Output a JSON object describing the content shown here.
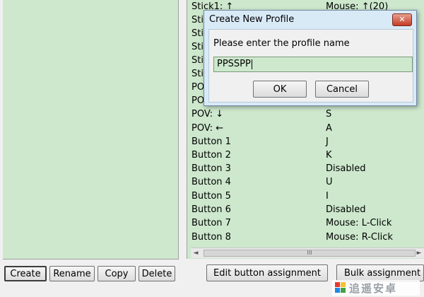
{
  "left_buttons": [
    "Create",
    "Rename",
    "Copy",
    "Delete"
  ],
  "mapping_rows": [
    {
      "key": "Stick1: ↑",
      "value": "Mouse: ↑(20)"
    },
    {
      "key": "Stic",
      "value": ""
    },
    {
      "key": "Stic",
      "value": ""
    },
    {
      "key": "Stic",
      "value": ""
    },
    {
      "key": "Stic",
      "value": ""
    },
    {
      "key": "Stic",
      "value": ""
    },
    {
      "key": "POV",
      "value": ""
    },
    {
      "key": "POV",
      "value": ""
    },
    {
      "key": "POV: ↓",
      "value": "S"
    },
    {
      "key": "POV: ←",
      "value": "A"
    },
    {
      "key": "Button 1",
      "value": "J"
    },
    {
      "key": "Button 2",
      "value": "K"
    },
    {
      "key": "Button 3",
      "value": "Disabled"
    },
    {
      "key": "Button 4",
      "value": "U"
    },
    {
      "key": "Button 5",
      "value": "I"
    },
    {
      "key": "Button 6",
      "value": "Disabled"
    },
    {
      "key": "Button 7",
      "value": "Mouse: L-Click"
    },
    {
      "key": "Button 8",
      "value": "Mouse: R-Click"
    }
  ],
  "right_buttons": {
    "edit": "Edit button assignment",
    "bulk": "Bulk assignment w"
  },
  "scrollbar": {
    "left_arrow": "◄",
    "right_arrow": "►",
    "grip": "III"
  },
  "dialog": {
    "title": "Create New Profile",
    "close_glyph": "✕",
    "prompt": "Please enter the profile name",
    "input_value": "PPSSPP",
    "ok": "OK",
    "cancel": "Cancel"
  },
  "watermark": {
    "text": "追遥安卓"
  },
  "colors": {
    "list_bg": "#cde8cd",
    "dialog_frame": "#d9eaf7",
    "close_red": "#c43b24"
  }
}
